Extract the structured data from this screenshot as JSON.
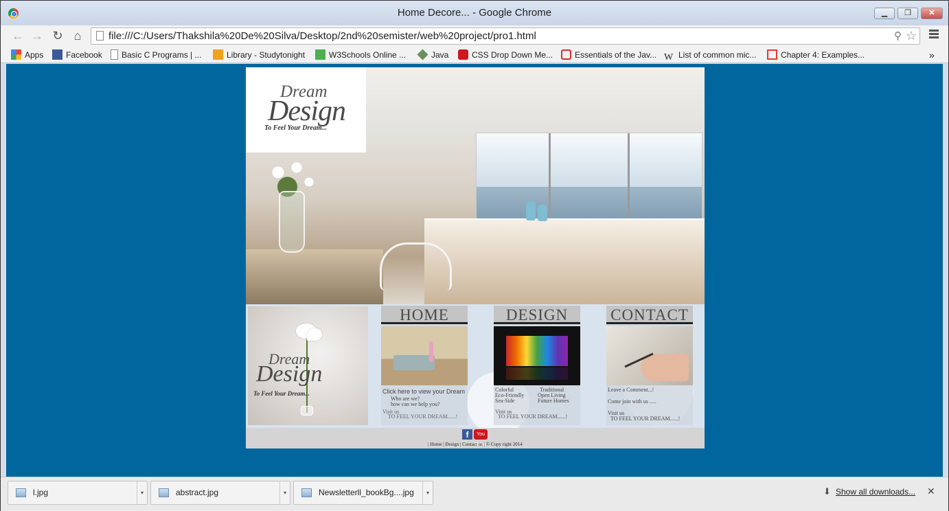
{
  "window": {
    "title": "Home Decore... - Google Chrome",
    "minimize": "▁",
    "maximize": "❐",
    "close": "✕"
  },
  "toolbar": {
    "back": "←",
    "forward": "→",
    "reload": "↻",
    "home": "⌂",
    "url": "file:///C:/Users/Thakshila%20De%20Silva/Desktop/2nd%20semister/web%20project/pro1.html",
    "search_icon": "⚲",
    "star": "☆"
  },
  "bookmarks": [
    {
      "label": "Apps",
      "icon": "apps-icon",
      "color": "#e8453c"
    },
    {
      "label": "Facebook",
      "icon": "facebook-icon",
      "color": "#3b5998"
    },
    {
      "label": "Basic C Programs | ...",
      "icon": "page-icon",
      "color": "#ffffff"
    },
    {
      "label": "Library - Studytonight",
      "icon": "studytonight-icon",
      "color": "#f0a21a"
    },
    {
      "label": "W3Schools Online ...",
      "icon": "w3schools-icon",
      "color": "#4caf50"
    },
    {
      "label": "Java",
      "icon": "java-icon",
      "color": "#6b8e5e"
    },
    {
      "label": "CSS Drop Down Me...",
      "icon": "youtube-icon",
      "color": "#cc181e"
    },
    {
      "label": "Essentials of the Jav...",
      "icon": "oracle-icon",
      "color": "#d32f2f"
    },
    {
      "label": "List of common mic...",
      "icon": "wikipedia-icon",
      "color": "#ffffff"
    },
    {
      "label": "Chapter 4: Examples...",
      "icon": "chapter-icon",
      "color": "#e53935"
    }
  ],
  "bookmarks_more": "»",
  "page": {
    "background": "#00669d",
    "logo": {
      "line1": "Dream",
      "line2": "Design",
      "tagline": "To Feel Your Dream..."
    },
    "panels": [
      {
        "heading": "HOME",
        "lines": [
          "Click here to view your Dream",
          "Who are we?",
          "how can we help you?",
          "Visit us",
          "TO FEEL YOUR DREAM......!"
        ]
      },
      {
        "heading": "DESIGN",
        "col1": [
          "Colorful",
          "Eco-Friendly",
          "Sea-Side"
        ],
        "col2": [
          "Traditional",
          "Open Living",
          "Future Homes"
        ],
        "visit": "Visit us",
        "tag": "TO FEEL YOUR DREAM......!"
      },
      {
        "heading": "CONTACT",
        "lines": [
          "Leave a Comment...!",
          "Come join with us .....",
          "Visit us",
          "TO FEEL YOUR DREAM......!"
        ]
      }
    ],
    "footer": {
      "fb": "f",
      "yt": "You Tube",
      "links": "| Home | Design | Contact us | © Copy right 2014"
    }
  },
  "downloads": [
    {
      "name": "l.jpg"
    },
    {
      "name": "abstract.jpg"
    },
    {
      "name": "Newsletterll_bookBg....jpg"
    }
  ],
  "downloads_show_all": "Show all downloads...",
  "downloads_close": "✕",
  "dropdown_arrow": "▾"
}
